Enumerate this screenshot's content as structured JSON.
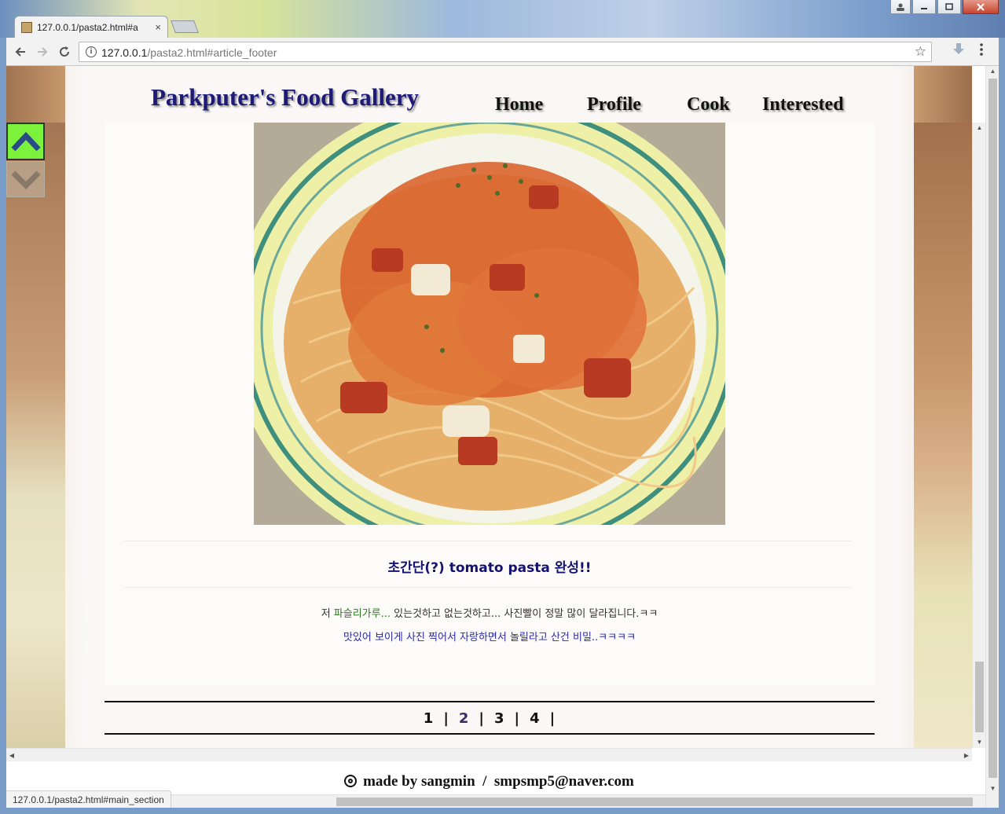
{
  "browser": {
    "tab_title": "127.0.0.1/pasta2.html#a",
    "tab_close": "×",
    "address_host": "127.0.0.1",
    "address_path": "/pasta2.html#article_footer",
    "status_url": "127.0.0.1/pasta2.html#main_section"
  },
  "site": {
    "title": "Parkputer's Food Gallery",
    "nav": [
      {
        "label": "Home"
      },
      {
        "label": "Profile"
      },
      {
        "label": "Cook"
      },
      {
        "label": "Interested"
      }
    ]
  },
  "article": {
    "caption": "초간단(?) tomato pasta 완성!!",
    "line1_prefix": "저 ",
    "line1_highlight": "파슬리가루...",
    "line1_rest": " 있는것하고 없는것하고... 사진빨이 정말 많이 달라집니다.ㅋㅋ",
    "line2": "맛있어 보이게 사진 찍어서 자랑하면서 놀릴라고 산건 비밀..ㅋㅋㅋㅋ"
  },
  "pager": {
    "pages": [
      "1",
      "2",
      "3",
      "4"
    ],
    "separator": "|"
  },
  "footer": {
    "text": "made by sangmin  /  smpsmp5@naver.com"
  },
  "colors": {
    "title": "#1d1a78",
    "caption": "#141270",
    "highlight": "#2c7a1f",
    "line2": "#2a2aa0",
    "scroll_up_bg": "#7cf23c"
  },
  "icons": {
    "scroll_up": "chevron-up-icon",
    "scroll_down": "chevron-down-icon",
    "back": "arrow-left-icon",
    "forward": "arrow-right-icon",
    "reload": "reload-icon",
    "info": "info-icon",
    "bookmark": "star-icon",
    "download": "download-icon",
    "menu": "kebab-menu-icon",
    "footer": "copyright-icon"
  }
}
